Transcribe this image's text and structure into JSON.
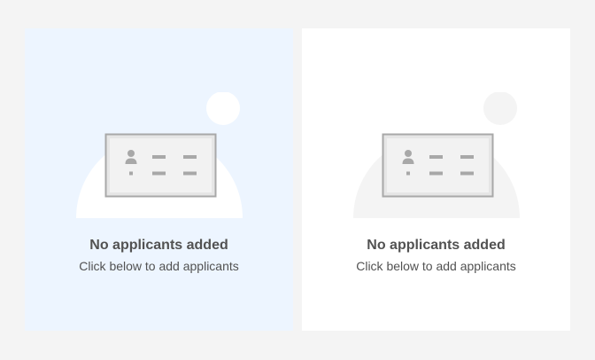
{
  "cards": [
    {
      "title": "No applicants added",
      "subtitle": "Click below to add applicants"
    },
    {
      "title": "No applicants added",
      "subtitle": "Click below to add applicants"
    }
  ],
  "colors": {
    "page_background": "#f4f4f4",
    "selected_card_background": "#edf5ff",
    "card_background": "#ffffff",
    "text": "#525252"
  },
  "icons": {
    "illustration": "empty-applicant-card-illustration"
  }
}
